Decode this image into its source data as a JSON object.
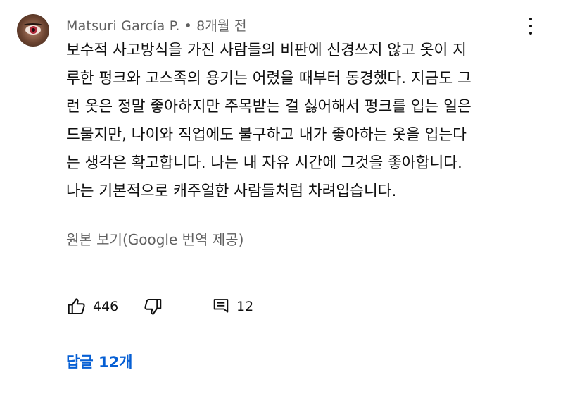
{
  "comment": {
    "author": "Matsuri García P.",
    "separator": "•",
    "time": "8개월 전",
    "text_lines": [
      "보수적 사고방식을 가진 사람들의 비판에 신경쓰지 않고 옷이 지",
      "루한 펑크와 고스족의 용기는 어렸을 때부터 동경했다. 지금도 그",
      "런 옷은 정말 좋아하지만 주목받는 걸 싫어해서 펑크를 입는 일은",
      "드물지만, 나이와 직업에도 불구하고 내가 좋아하는 옷을 입는다",
      "는 생각은 확고합니다. 나는 내 자유 시간에 그것을 좋아합니다.",
      "나는 기본적으로 캐주얼한 사람들처럼 차려입습니다."
    ],
    "translate_link": "원본 보기(Google 번역 제공)",
    "like_count": "446",
    "reply_count": "12",
    "replies_link": "답글 12개"
  },
  "icons": {
    "menu": "more-vert-icon",
    "like": "thumbs-up-icon",
    "dislike": "thumbs-down-icon",
    "reply": "comment-reply-icon"
  },
  "colors": {
    "text": "#0f0f0f",
    "secondary": "#606060",
    "link": "#065fd4"
  }
}
